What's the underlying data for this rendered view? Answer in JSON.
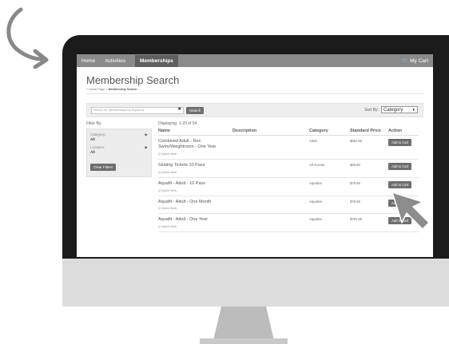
{
  "nav": {
    "items": [
      "Home",
      "Activities",
      "Memberships"
    ],
    "cart_label": "My Cart",
    "cart_icon": "cart-icon"
  },
  "page": {
    "title": "Membership Search",
    "breadcrumb": {
      "home": "« Home Page »",
      "current": "Membership Search"
    }
  },
  "search": {
    "placeholder": "Search for Memberships by keywords",
    "button": "Search",
    "sort_label": "Sort By:",
    "sort_value": "Category"
  },
  "filters": {
    "heading": "Filter By:",
    "groups": [
      {
        "label": "Category:",
        "value": "All"
      },
      {
        "label": "Location:",
        "value": "All"
      }
    ],
    "clear": "Clear Filters"
  },
  "results": {
    "displaying": "Displaying: 1-20 of 54",
    "columns": [
      "Name",
      "Description",
      "Category",
      "Standard Price",
      "Action"
    ],
    "quick_view": "Q Quick View",
    "add_label": "Add to Cart",
    "rows": [
      {
        "name": "Combined Adult - Rec Swim/Weightroom - One Year",
        "category": "Adult",
        "price": "$581.50"
      },
      {
        "name": "Skating Tickets 10 Pass",
        "category": "All Access",
        "price": "$25.50"
      },
      {
        "name": "Aquafit - Adult - 10 Pass",
        "category": "Aquatics",
        "price": "$78.55"
      },
      {
        "name": "Aquafit - Adult - One Month",
        "category": "Aquatics",
        "price": "$78.55"
      },
      {
        "name": "Aquafit - Adult - One Year",
        "category": "Aquatics",
        "price": "$781.65"
      }
    ]
  },
  "colors": {
    "bezel": "#1b1b1b",
    "chin": "#dcdcdc",
    "nav": "#8a8a8a",
    "button": "#6e6e6e"
  }
}
